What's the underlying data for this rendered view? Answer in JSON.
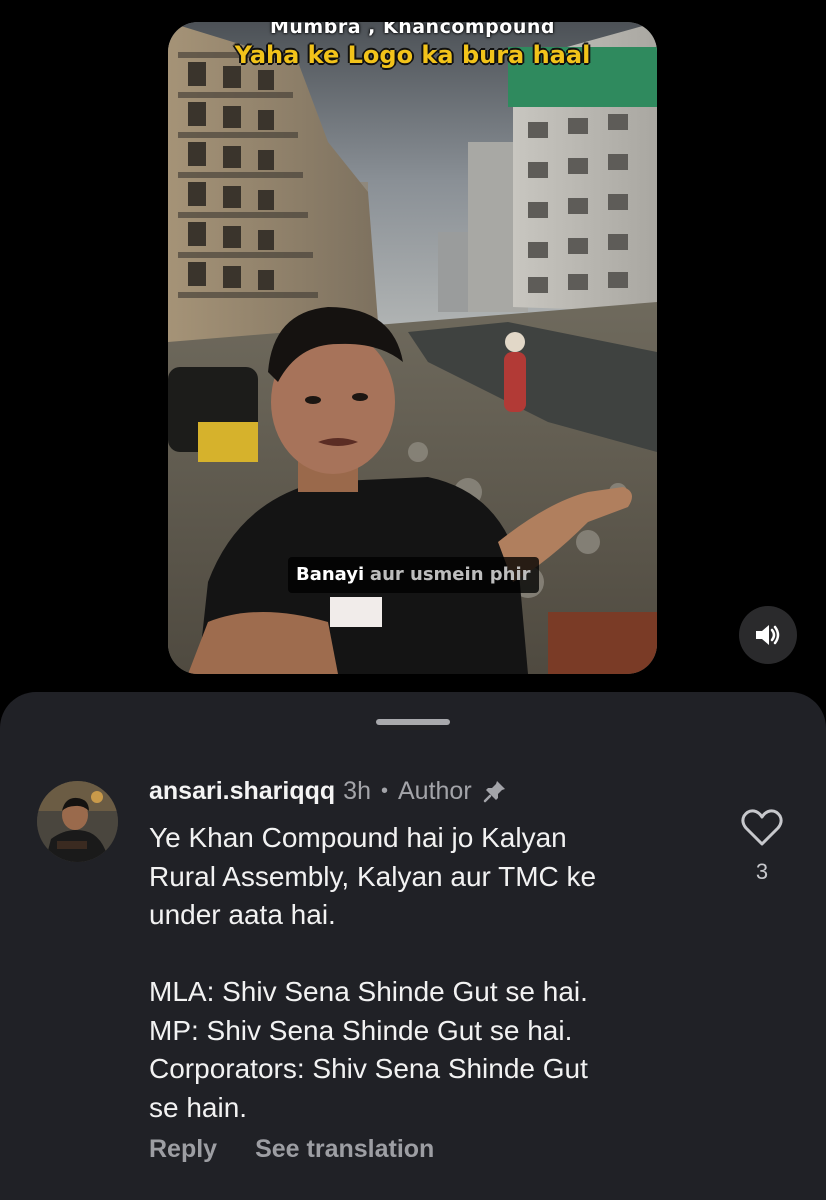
{
  "video": {
    "location_text": "Mumbra , Khancompound",
    "headline_text": "Yaha ke Logo ka bura haal",
    "caption_highlight": "Banayi",
    "caption_rest": "aur usmein phir",
    "sound_icon": "speaker-icon"
  },
  "comment": {
    "username": "ansari.shariqqq",
    "time": "3h",
    "separator": "•",
    "author_label": "Author",
    "pin_icon": "pin-icon",
    "body_lines": [
      "Ye Khan Compound hai jo Kalyan",
      "Rural Assembly, Kalyan aur TMC ke",
      "under aata hai.",
      "MLA: Shiv Sena Shinde Gut se hai.",
      "MP: Shiv Sena Shinde Gut se hai.",
      "Corporators: Shiv Sena Shinde Gut",
      "se hain."
    ],
    "like_count": "3",
    "like_icon": "heart-icon",
    "reply_label": "Reply",
    "translate_label": "See translation"
  },
  "colors": {
    "background": "#000000",
    "sheet": "#202126",
    "headline_yellow": "#f2c31a",
    "muted_text": "#a3a4a9",
    "primary_text": "#f2f2f2"
  }
}
